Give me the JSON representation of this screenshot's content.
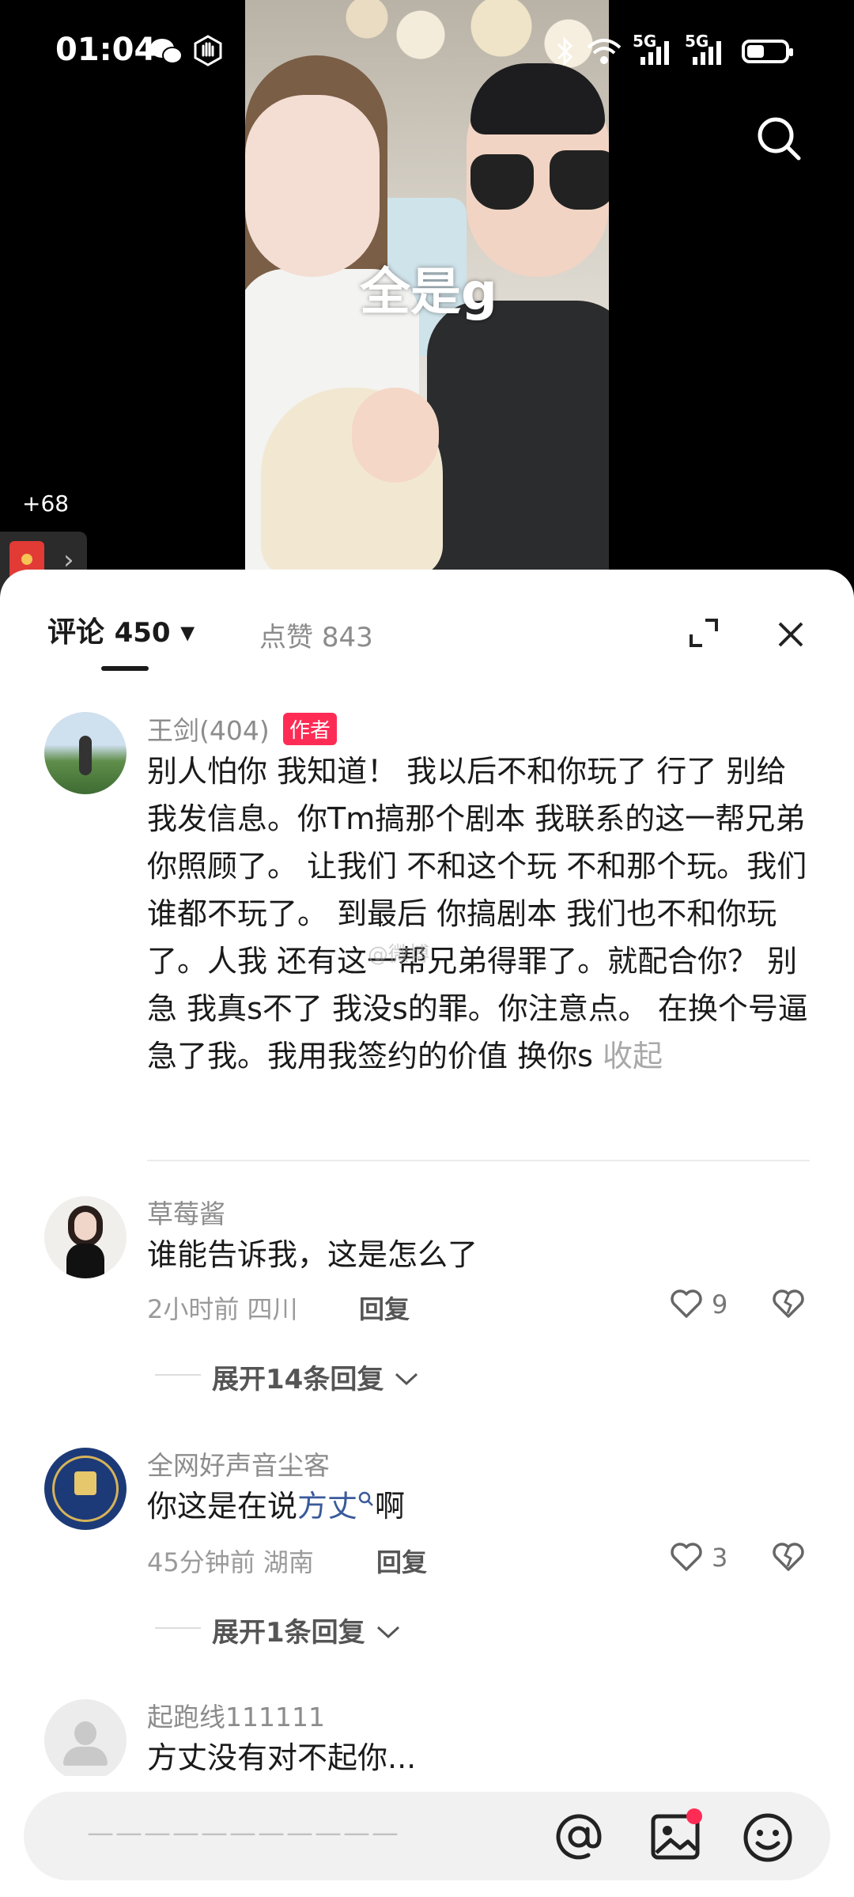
{
  "status_bar": {
    "time": "01:04",
    "icons": [
      "wechat-icon",
      "hand-icon",
      "bluetooth-icon",
      "wifi-icon",
      "signal-5g-icon",
      "signal-5g-icon",
      "battery-icon"
    ],
    "net1": "5G",
    "net2": "5G",
    "battery_level": 0.4
  },
  "video": {
    "overlay_text": "全是g",
    "search_icon": "search-icon"
  },
  "red_packet": {
    "count": "+68",
    "arrow": "›"
  },
  "tabs": {
    "comments_label": "评论",
    "comments_count": "450",
    "dropdown_arrow": "▾",
    "likes_label": "点赞",
    "likes_count": "843"
  },
  "comments": [
    {
      "username": "王剑(404)",
      "author_tag": "作者",
      "text": "别人怕你 我知道！ 我以后不和你玩了 行了 别给我发信息。你Tm搞那个剧本 我联系的这一帮兄弟你照顾了。 让我们 不和这个玩 不和那个玩。我们谁都不玩了。 到最后 你搞剧本 我们也不和你玩了。人我 还有这一帮兄弟得罪了。就配合你？ 别急 我真s不了 我没s的罪。你注意点。 在换个号逼急了我。我用我签约的价值 换你s",
      "collapse_label": "收起"
    },
    {
      "username": "草莓酱",
      "text": "谁能告诉我，这是怎么了",
      "time": "2小时前",
      "location": "四川",
      "reply_label": "回复",
      "likes": "9",
      "expand_label": "展开14条回复"
    },
    {
      "username": "全网好声音尘客",
      "text_before": "你这是在说",
      "text_link": "方丈",
      "text_after": "啊",
      "time": "45分钟前",
      "location": "湖南",
      "reply_label": "回复",
      "likes": "3",
      "expand_label": "展开1条回复"
    },
    {
      "username": "起跑线111111",
      "text": "方丈没有对不起你..."
    }
  ],
  "input_bar": {
    "placeholder": "———————————"
  },
  "watermark": "@微博"
}
